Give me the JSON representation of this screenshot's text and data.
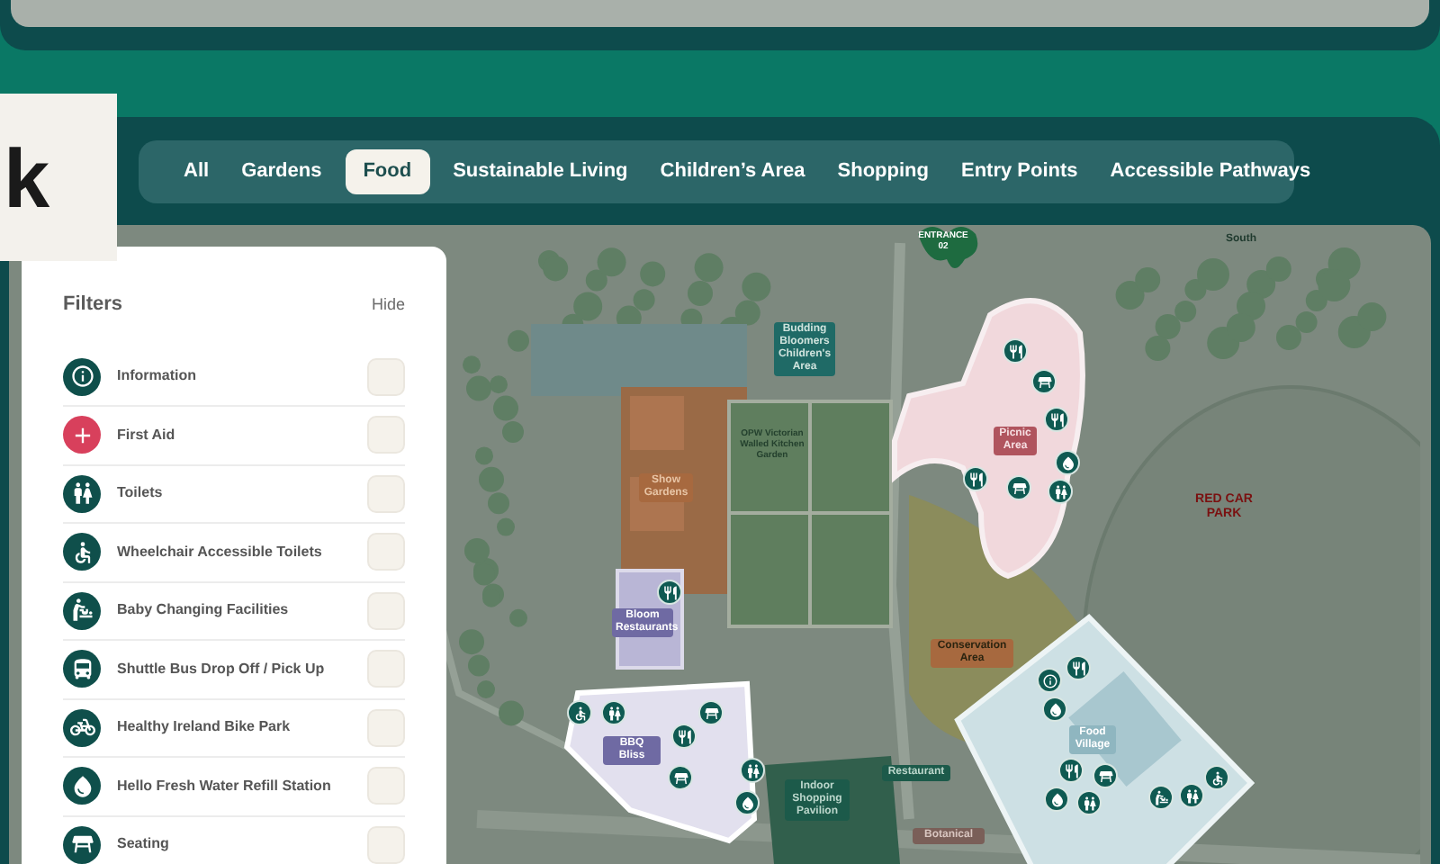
{
  "logo": "k",
  "tabs": [
    {
      "label": "All",
      "selected": false
    },
    {
      "label": "Gardens",
      "selected": false
    },
    {
      "label": "Food",
      "selected": true
    },
    {
      "label": "Sustainable Living",
      "selected": false
    },
    {
      "label": "Children’s Area",
      "selected": false
    },
    {
      "label": "Shopping",
      "selected": false
    },
    {
      "label": "Entry Points",
      "selected": false
    },
    {
      "label": "Accessible Pathways",
      "selected": false
    }
  ],
  "filters": {
    "title": "Filters",
    "hide": "Hide",
    "items": [
      {
        "label": "Information",
        "kind": "info",
        "checked": false
      },
      {
        "label": "First Aid",
        "kind": "first-aid",
        "checked": false
      },
      {
        "label": "Toilets",
        "kind": "toilets",
        "checked": false
      },
      {
        "label": "Wheelchair Accessible Toilets",
        "kind": "wheelchair",
        "checked": false
      },
      {
        "label": "Baby Changing Facilities",
        "kind": "baby",
        "checked": false
      },
      {
        "label": "Shuttle Bus Drop Off / Pick Up",
        "kind": "bus",
        "checked": false
      },
      {
        "label": "Healthy Ireland Bike Park",
        "kind": "bike",
        "checked": false
      },
      {
        "label": "Hello Fresh Water Refill Station",
        "kind": "water",
        "checked": false
      },
      {
        "label": "Seating",
        "kind": "seating",
        "checked": false
      }
    ]
  },
  "map": {
    "labels": [
      {
        "text": "ENTRANCE 02",
        "kind": "entrance"
      },
      {
        "text": "South",
        "kind": "plain"
      },
      {
        "text": "Budding Bloomers Children's Area",
        "kind": "children"
      },
      {
        "text": "OPW Victorian Walled Kitchen Garden",
        "kind": "garden"
      },
      {
        "text": "Show Gardens",
        "kind": "show"
      },
      {
        "text": "Picnic Area",
        "kind": "picnic"
      },
      {
        "text": "RED CAR PARK",
        "kind": "carpark"
      },
      {
        "text": "Bloom Restaurants",
        "kind": "bloom"
      },
      {
        "text": "Conservation Area",
        "kind": "conservation"
      },
      {
        "text": "BBQ Bliss",
        "kind": "bbq"
      },
      {
        "text": "Food Village",
        "kind": "village"
      },
      {
        "text": "Restaurant",
        "kind": "restaurant"
      },
      {
        "text": "Indoor Shopping Pavilion",
        "kind": "pavilion"
      },
      {
        "text": "Botanical",
        "kind": "botanical"
      }
    ]
  }
}
